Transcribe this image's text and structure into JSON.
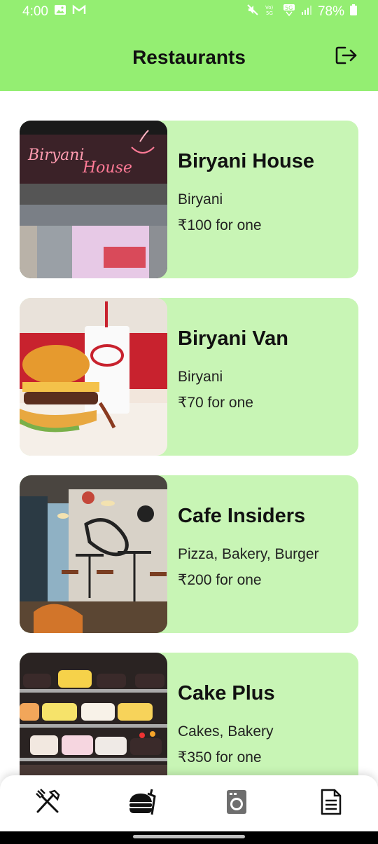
{
  "status_bar": {
    "time": "4:00",
    "battery": "78%",
    "icons": [
      "image-icon",
      "gmail-icon",
      "mute-icon",
      "volte-icon",
      "5g-icon",
      "signal-icon",
      "battery-icon"
    ]
  },
  "header": {
    "title": "Restaurants",
    "action_icon": "logout-icon"
  },
  "restaurants": [
    {
      "name": "Biryani House",
      "cuisine": "Biryani",
      "price": "₹100 for one",
      "image": "biryani-house-storefront"
    },
    {
      "name": "Biryani Van",
      "cuisine": "Biryani",
      "price": "₹70 for one",
      "image": "burger-and-drink"
    },
    {
      "name": "Cafe Insiders",
      "cuisine": "Pizza, Bakery, Burger",
      "price": "₹200 for one",
      "image": "cafe-interior"
    },
    {
      "name": "Cake Plus",
      "cuisine": "Cakes, Bakery",
      "price": "₹350 for one",
      "image": "cake-display"
    }
  ],
  "storefront_sign": {
    "line1": "Biryani",
    "line2": "House"
  },
  "bottom_nav": [
    {
      "icon": "fork-knife-icon",
      "active": false
    },
    {
      "icon": "food-delivery-icon",
      "active": true
    },
    {
      "icon": "laundry-icon",
      "active": false
    },
    {
      "icon": "document-icon",
      "active": false
    }
  ],
  "colors": {
    "header_bg": "#94ee72",
    "card_bg": "#c8f5b5",
    "text": "#111111"
  }
}
